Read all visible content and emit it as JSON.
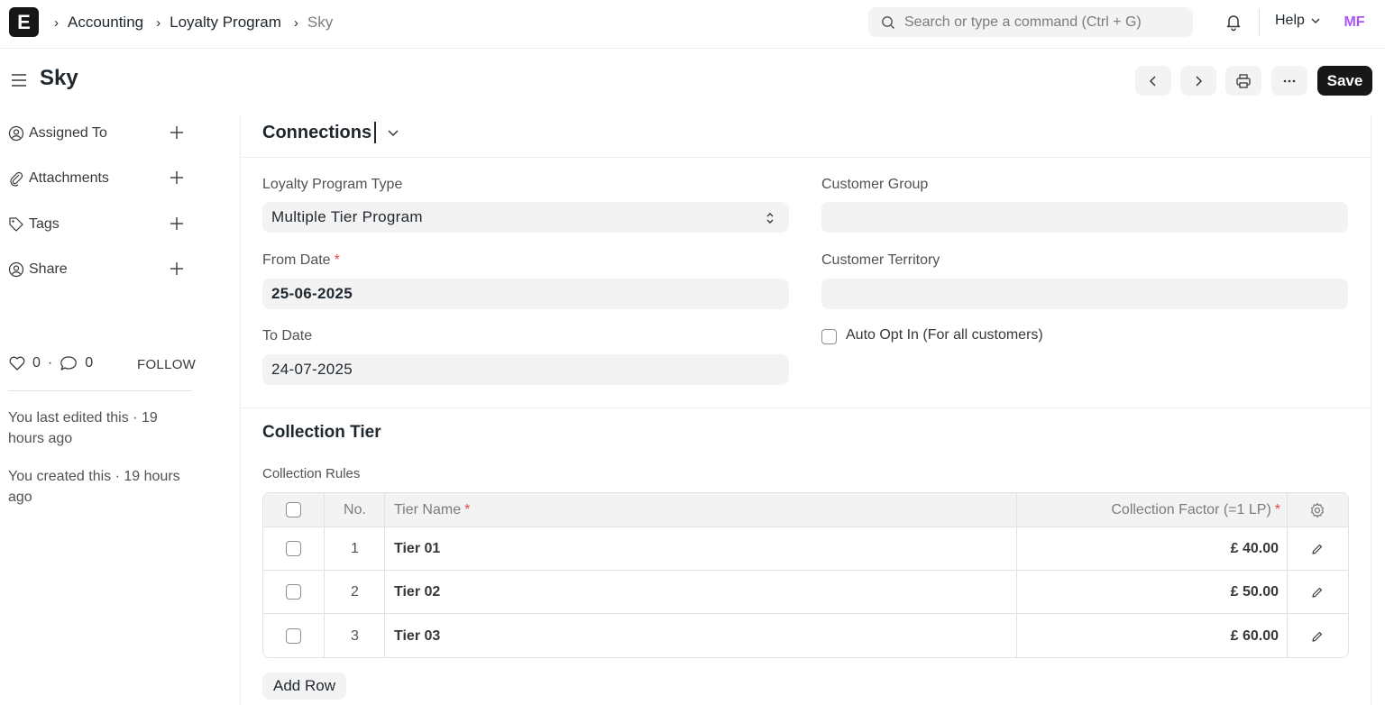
{
  "navbar": {
    "logo": "E",
    "breadcrumbs": [
      "Accounting",
      "Loyalty Program",
      "Sky"
    ],
    "search_placeholder": "Search or type a command (Ctrl + G)",
    "help_label": "Help",
    "avatar_initials": "MF"
  },
  "page": {
    "title": "Sky",
    "save_label": "Save"
  },
  "sidebar": {
    "items": [
      {
        "label": "Assigned To",
        "icon": "user-assign-icon"
      },
      {
        "label": "Attachments",
        "icon": "paperclip-icon"
      },
      {
        "label": "Tags",
        "icon": "tag-icon"
      },
      {
        "label": "Share",
        "icon": "share-user-icon"
      }
    ],
    "likes": "0",
    "comments": "0",
    "follow_label": "FOLLOW",
    "last_edited": "You last edited this · 19 hours ago",
    "created": "You created this · 19 hours ago"
  },
  "form": {
    "section_title": "Connections",
    "loyalty_program_type": {
      "label": "Loyalty Program Type",
      "value": "Multiple Tier Program"
    },
    "from_date": {
      "label": "From Date",
      "value": "25-06-2025",
      "required_mark": "*"
    },
    "to_date": {
      "label": "To Date",
      "value": "24-07-2025"
    },
    "customer_group": {
      "label": "Customer Group",
      "value": ""
    },
    "customer_territory": {
      "label": "Customer Territory",
      "value": ""
    },
    "auto_opt_in": {
      "label": "Auto Opt In (For all customers)",
      "checked": false
    }
  },
  "collection": {
    "section_title": "Collection Tier",
    "table_label": "Collection Rules",
    "columns": {
      "no": "No.",
      "tier_name": "Tier Name",
      "factor": "Collection Factor (=1 LP)",
      "required_mark": "*"
    },
    "rows": [
      {
        "no": "1",
        "tier_name": "Tier 01",
        "factor": "£ 40.00"
      },
      {
        "no": "2",
        "tier_name": "Tier 02",
        "factor": "£ 50.00"
      },
      {
        "no": "3",
        "tier_name": "Tier 03",
        "factor": "£ 60.00"
      }
    ],
    "add_row_label": "Add Row"
  },
  "colors": {
    "primary_dark": "#171717",
    "field_bg": "#f3f3f3",
    "required_red": "#e24c4c",
    "avatar_purple": "#a855f7"
  }
}
